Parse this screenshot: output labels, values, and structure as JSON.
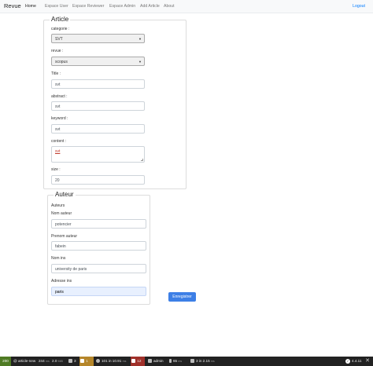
{
  "nav": {
    "brand": "Revue",
    "links": [
      "Home",
      "Espace User",
      "Espace Reviewer",
      "Espace Admin",
      "Add Article",
      "About"
    ],
    "logout": "Logout"
  },
  "article": {
    "legend": "Article",
    "categorie": {
      "label": "categorie :",
      "value": "SVT"
    },
    "revue": {
      "label": "revue :",
      "value": "scopus"
    },
    "title": {
      "label": "Title :",
      "value": "svt"
    },
    "abstract": {
      "label": "abstract :",
      "value": "svt"
    },
    "keyword": {
      "label": "keyword :",
      "value": "svt"
    },
    "content": {
      "label": "content :",
      "value": "svt"
    },
    "size": {
      "label": "size :",
      "value": "20"
    }
  },
  "auteur": {
    "legend": "Auteur",
    "heading": "Auteurs",
    "nom": {
      "label": "Nom auteur",
      "value": "potencier"
    },
    "prenom": {
      "label": "Prenom auteur",
      "value": "fabein"
    },
    "nom_ins": {
      "label": "Nom ins",
      "value": "university de paris"
    },
    "adresse_ins": {
      "label": "Adresse ins",
      "value": "paris"
    }
  },
  "submit_label": "Enregistrer",
  "toolbar": {
    "status": "200",
    "route": "article-new",
    "time": "244",
    "time_unit": "ms",
    "memory": "2.0",
    "memory_unit": "MiB",
    "forms": "3",
    "logs": "1",
    "cache": "101 in 10.91",
    "cache_unit": "ms",
    "errors": "12",
    "user": "admin",
    "twig": "65",
    "twig_unit": "ms",
    "db": "3 in 2.15",
    "db_unit": "ms",
    "version": "4.4.11"
  }
}
